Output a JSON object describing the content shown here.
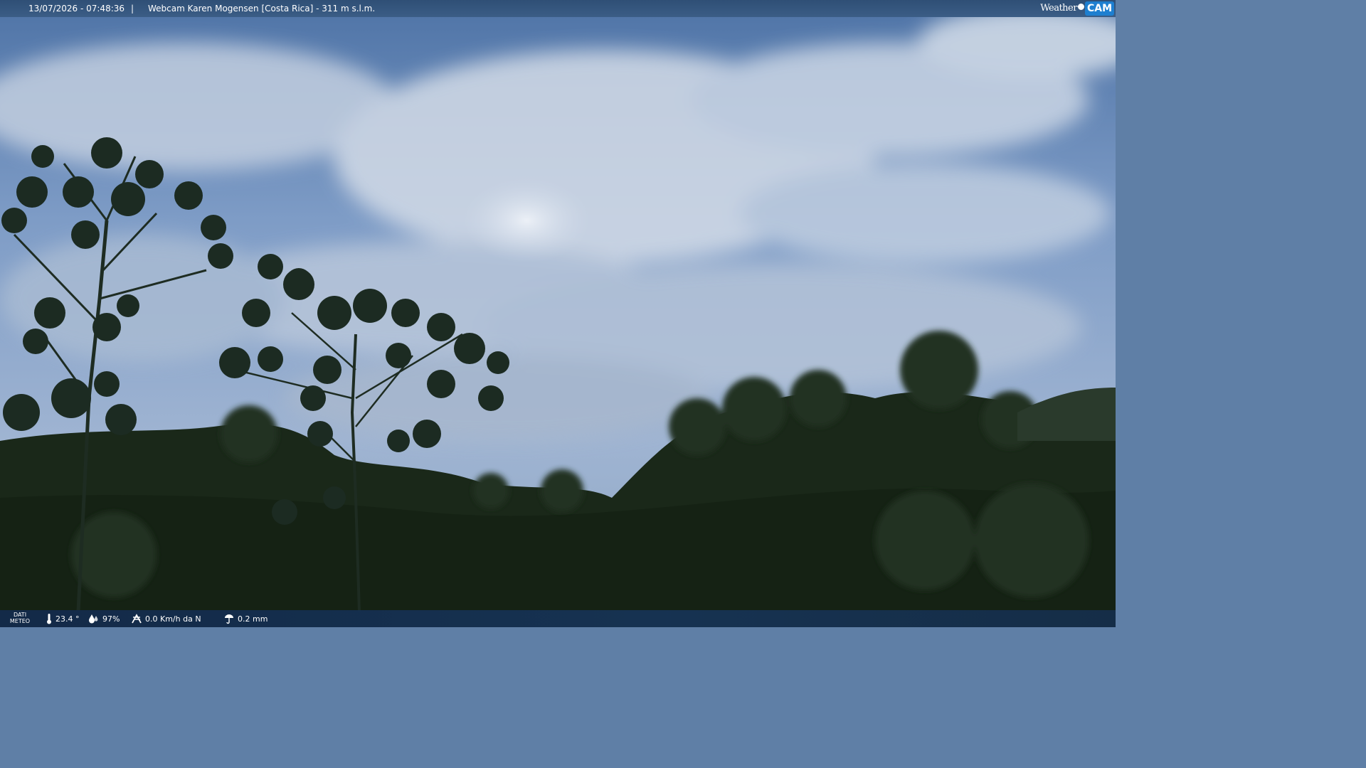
{
  "topbar": {
    "datetime": "13/07/2026 - 07:48:36",
    "separator": "|",
    "title": "Webcam Karen Mogensen [Costa Rica] - 311 m s.l.m."
  },
  "logo": {
    "weather_text": "Weather",
    "cam_text": "CAM"
  },
  "weather_bar": {
    "label_line1": "DATI",
    "label_line2": "METEO",
    "temperature": "23.4 °",
    "humidity": "97%",
    "wind": "0.0 Km/h da N",
    "rain": "0.2 mm"
  },
  "icons": [
    "thermometer-icon",
    "humidity-drop-icon",
    "wind-icon",
    "rain-icon"
  ],
  "colors": {
    "bar": "#2f4f76",
    "logo_cam": "#1e7fd0",
    "sky": "#8fa9cc",
    "foliage": "#1c2b1a"
  }
}
